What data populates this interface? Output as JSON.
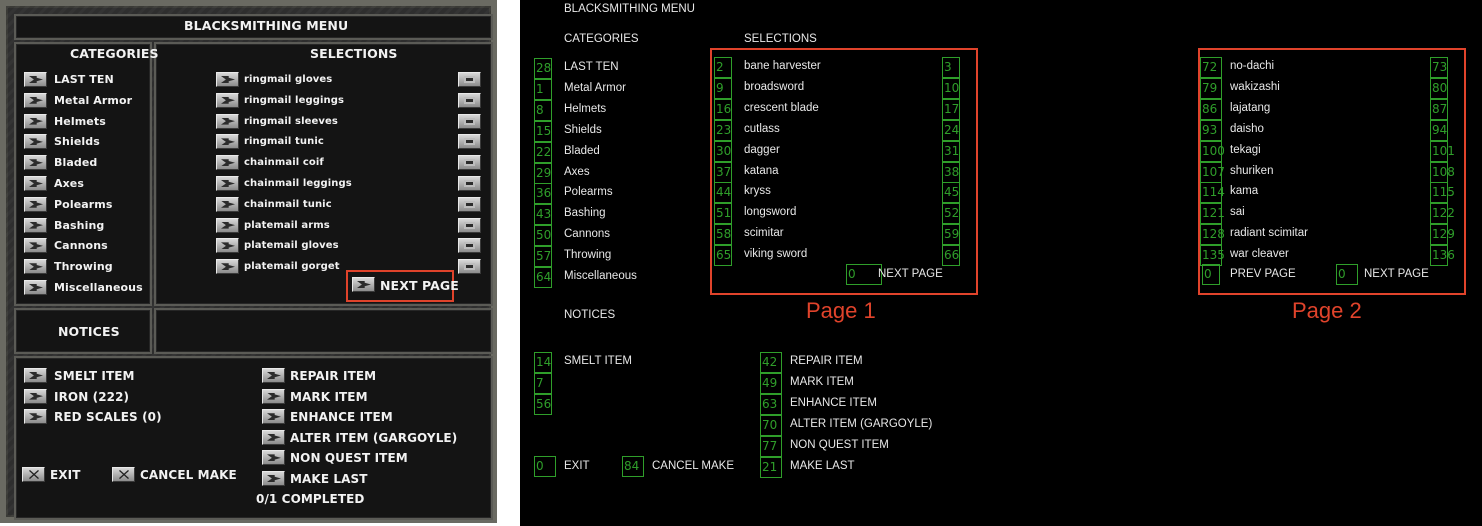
{
  "game": {
    "title": "BLACKSMITHING MENU",
    "categories_header": "CATEGORIES",
    "selections_header": "SELECTIONS",
    "notices_header": "NOTICES",
    "categories": [
      "LAST TEN",
      "Metal Armor",
      "Helmets",
      "Shields",
      "Bladed",
      "Axes",
      "Polearms",
      "Bashing",
      "Cannons",
      "Throwing",
      "Miscellaneous"
    ],
    "selections": [
      "ringmail gloves",
      "ringmail leggings",
      "ringmail sleeves",
      "ringmail tunic",
      "chainmail coif",
      "chainmail leggings",
      "chainmail tunic",
      "platemail arms",
      "platemail gloves",
      "platemail gorget"
    ],
    "next_page": "NEXT PAGE",
    "left_actions": [
      "SMELT ITEM",
      "IRON (222)",
      "RED SCALES (0)"
    ],
    "right_actions": [
      "REPAIR ITEM",
      "MARK ITEM",
      "ENHANCE ITEM",
      "ALTER ITEM (GARGOYLE)",
      "NON QUEST ITEM",
      "MAKE LAST"
    ],
    "exit": "EXIT",
    "cancel_make": "CANCEL MAKE",
    "completed": "0/1 COMPLETED"
  },
  "schematic": {
    "title": "BLACKSMITHING MENU",
    "categories_header": "CATEGORIES",
    "selections_header": "SELECTIONS",
    "notices_header": "NOTICES",
    "categories": [
      {
        "id": "28",
        "label": "LAST TEN"
      },
      {
        "id": "1",
        "label": "Metal Armor"
      },
      {
        "id": "8",
        "label": "Helmets"
      },
      {
        "id": "15",
        "label": "Shields"
      },
      {
        "id": "22",
        "label": "Bladed"
      },
      {
        "id": "29",
        "label": "Axes"
      },
      {
        "id": "36",
        "label": "Polearms"
      },
      {
        "id": "43",
        "label": "Bashing"
      },
      {
        "id": "50",
        "label": "Cannons"
      },
      {
        "id": "57",
        "label": "Throwing"
      },
      {
        "id": "64",
        "label": "Miscellaneous"
      }
    ],
    "page1": [
      {
        "id": "2",
        "label": "bane harvester",
        "info": "3"
      },
      {
        "id": "9",
        "label": "broadsword",
        "info": "10"
      },
      {
        "id": "16",
        "label": "crescent blade",
        "info": "17"
      },
      {
        "id": "23",
        "label": "cutlass",
        "info": "24"
      },
      {
        "id": "30",
        "label": "dagger",
        "info": "31"
      },
      {
        "id": "37",
        "label": "katana",
        "info": "38"
      },
      {
        "id": "44",
        "label": "kryss",
        "info": "45"
      },
      {
        "id": "51",
        "label": "longsword",
        "info": "52"
      },
      {
        "id": "58",
        "label": "scimitar",
        "info": "59"
      },
      {
        "id": "65",
        "label": "viking sword",
        "info": "66"
      }
    ],
    "page1_next": {
      "id": "0",
      "label": "NEXT PAGE"
    },
    "page2": [
      {
        "id": "72",
        "label": "no-dachi",
        "info": "73"
      },
      {
        "id": "79",
        "label": "wakizashi",
        "info": "80"
      },
      {
        "id": "86",
        "label": "lajatang",
        "info": "87"
      },
      {
        "id": "93",
        "label": "daisho",
        "info": "94"
      },
      {
        "id": "100",
        "label": "tekagi",
        "info": "101"
      },
      {
        "id": "107",
        "label": "shuriken",
        "info": "108"
      },
      {
        "id": "114",
        "label": "kama",
        "info": "115"
      },
      {
        "id": "121",
        "label": "sai",
        "info": "122"
      },
      {
        "id": "128",
        "label": "radiant scimitar",
        "info": "129"
      },
      {
        "id": "135",
        "label": "war cleaver",
        "info": "136"
      }
    ],
    "page2_prev": {
      "id": "0",
      "label": "PREV PAGE"
    },
    "page2_next": {
      "id": "0",
      "label": "NEXT PAGE"
    },
    "page1_label": "Page 1",
    "page2_label": "Page 2",
    "left_actions": [
      {
        "id": "14",
        "label": "SMELT ITEM"
      },
      {
        "id": "7",
        "label": ""
      },
      {
        "id": "56",
        "label": ""
      }
    ],
    "right_actions": [
      {
        "id": "42",
        "label": "REPAIR ITEM"
      },
      {
        "id": "49",
        "label": "MARK ITEM"
      },
      {
        "id": "63",
        "label": "ENHANCE ITEM"
      },
      {
        "id": "70",
        "label": "ALTER ITEM (GARGOYLE)"
      },
      {
        "id": "77",
        "label": "NON QUEST ITEM"
      },
      {
        "id": "21",
        "label": "MAKE LAST"
      }
    ],
    "exit": {
      "id": "0",
      "label": "EXIT"
    },
    "cancel_make": {
      "id": "84",
      "label": "CANCEL MAKE"
    }
  },
  "colors": {
    "highlight": "#e0432b",
    "schematic_green": "#2f9e2a"
  }
}
